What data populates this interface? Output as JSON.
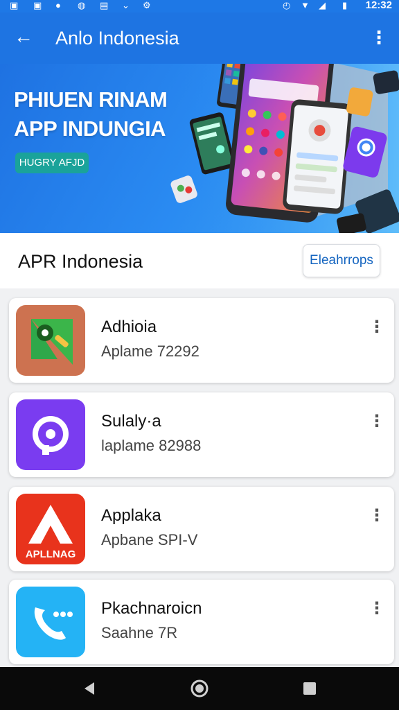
{
  "status_bar": {
    "time": "12:32",
    "icons": [
      "gallery-icon",
      "gallery-icon",
      "app-icon",
      "app-icon",
      "app-icon",
      "wifi-icon",
      "signal-icon",
      "battery-icon"
    ]
  },
  "app_bar": {
    "title": "Anlo Indonesia",
    "back_icon": "back-arrow-icon",
    "menu_icon": "more-vert-icon"
  },
  "hero": {
    "headline_line1": "PHIUEN RINAM",
    "headline_line2": "APP INDUNGIA",
    "chip_label": "HUGRY AFJD"
  },
  "section": {
    "title": "APR Indonesia",
    "button_label": "Eleahrrops"
  },
  "apps": [
    {
      "name": "Adhioia",
      "subtitle": "Aplame 72292",
      "icon": "green-triangle-gear-icon",
      "colors": [
        "#f39a1d",
        "#3bb54a"
      ]
    },
    {
      "name": "Sulaly·a",
      "subtitle": "laplame 82988",
      "icon": "purple-logo-icon",
      "colors": [
        "#7a3cf0",
        "#a15ce8"
      ]
    },
    {
      "name": "Applaka",
      "subtitle": "Apbane SPI-V",
      "icon": "red-a-logo-icon",
      "icon_text": "APLLNAG",
      "colors": [
        "#e8331c",
        "#c01a14"
      ]
    },
    {
      "name": "Pkachnaroicn",
      "subtitle": "Saahne 7R",
      "icon": "phone-call-icon",
      "colors": [
        "#24b3f5",
        "#12a2ef"
      ]
    }
  ],
  "nav_bar": {
    "buttons": [
      "back-triangle-icon",
      "home-circle-icon",
      "recents-square-icon"
    ]
  }
}
